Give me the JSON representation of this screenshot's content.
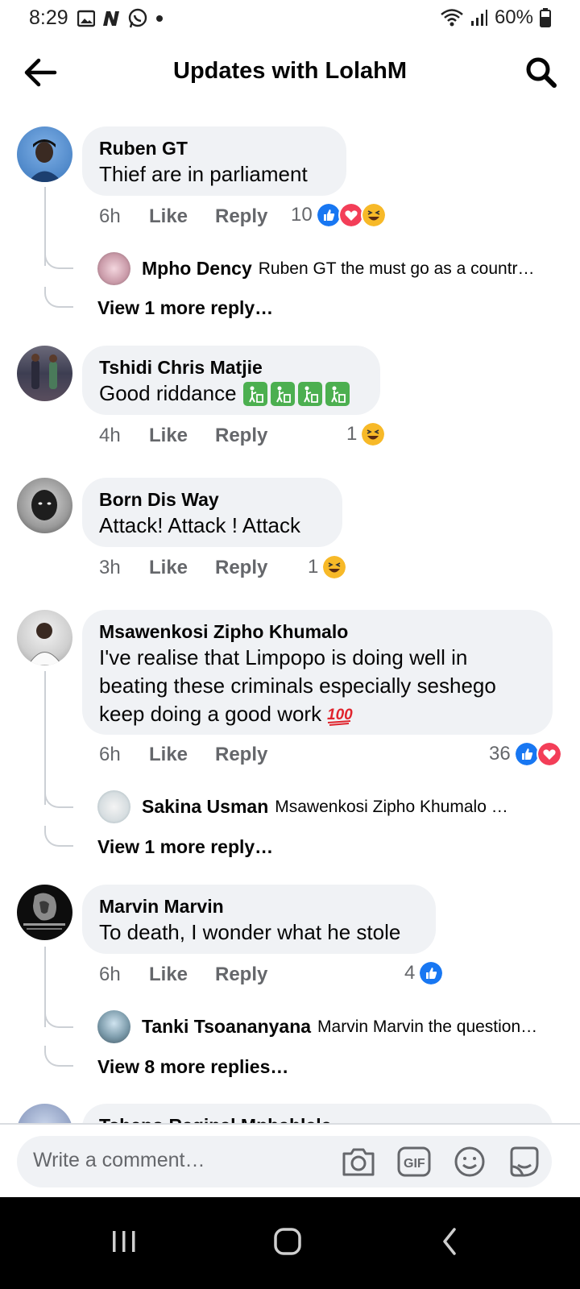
{
  "status_bar": {
    "time": "8:29",
    "battery": "60%"
  },
  "header": {
    "title": "Updates with LolahM"
  },
  "comments": [
    {
      "author": "Ruben GT",
      "text": "Thief are in parliament",
      "time": "6h",
      "like_label": "Like",
      "reply_label": "Reply",
      "reaction_count": "10",
      "reactions": [
        "like",
        "love",
        "haha"
      ],
      "reply_preview": {
        "author": "Mpho Dency",
        "snippet": "Ruben GT the must go as a countr…"
      },
      "view_more": "View 1 more reply…"
    },
    {
      "author": "Tshidi Chris Matjie",
      "text": "Good riddance",
      "emoji": [
        "litter-bin-icon",
        "litter-bin-icon",
        "litter-bin-icon",
        "litter-bin-icon"
      ],
      "time": "4h",
      "like_label": "Like",
      "reply_label": "Reply",
      "reaction_count": "1",
      "reactions": [
        "haha"
      ]
    },
    {
      "author": "Born Dis Way",
      "text": "Attack! Attack ! Attack",
      "time": "3h",
      "like_label": "Like",
      "reply_label": "Reply",
      "reaction_count": "1",
      "reactions": [
        "haha"
      ]
    },
    {
      "author": "Msawenkosi Zipho Khumalo",
      "text_lines": [
        "I've realise that Limpopo is doing well in",
        "beating these criminals especially seshego",
        "keep doing a good work"
      ],
      "emoji": [
        "hundred-points-icon"
      ],
      "time": "6h",
      "like_label": "Like",
      "reply_label": "Reply",
      "reaction_count": "36",
      "reactions": [
        "like",
        "love"
      ],
      "reply_preview": {
        "author": "Sakina Usman",
        "snippet": "Msawenkosi Zipho Khumalo …"
      },
      "view_more": "View 1 more reply…"
    },
    {
      "author": "Marvin Marvin",
      "text": "To death, I wonder what he stole",
      "time": "6h",
      "like_label": "Like",
      "reply_label": "Reply",
      "reaction_count": "4",
      "reactions": [
        "like"
      ],
      "reply_preview": {
        "author": "Tanki Tsoananyana",
        "snippet": "Marvin Marvin the question…"
      },
      "view_more": "View 8 more replies…"
    },
    {
      "author": "Tshepo Reginal Mphahlele"
    }
  ],
  "composer": {
    "placeholder": "Write a comment…",
    "icons": [
      "camera-icon",
      "gif-icon",
      "emoji-icon",
      "sticker-icon"
    ]
  },
  "colors": {
    "like_blue": "#1877f2",
    "love_red": "#f33e58",
    "haha_yellow": "#f7b928",
    "bubble_gray": "#f0f2f5",
    "meta_gray": "#65676b"
  }
}
